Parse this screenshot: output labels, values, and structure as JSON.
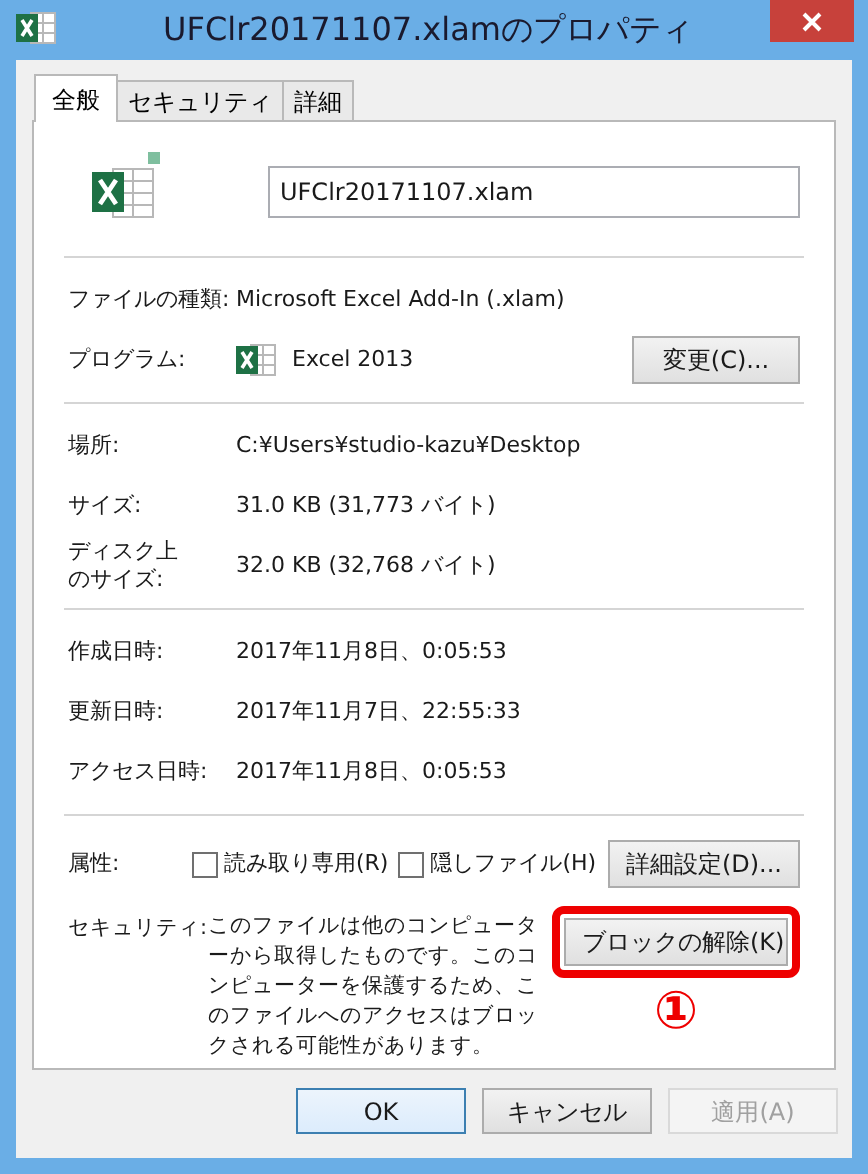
{
  "window": {
    "title": "UFClr20171107.xlamのプロパティ"
  },
  "tabs": [
    {
      "label": "全般",
      "selected": true
    },
    {
      "label": "セキュリティ",
      "selected": false
    },
    {
      "label": "詳細",
      "selected": false
    }
  ],
  "file_name": "UFClr20171107.xlam",
  "sections": [
    {
      "rows": [
        {
          "kind": "text",
          "label": "ファイルの種類:",
          "value": "Microsoft Excel Add-In (.xlam)"
        },
        {
          "kind": "program",
          "label": "プログラム:",
          "value": "Excel 2013",
          "button": "変更(C)..."
        }
      ]
    },
    {
      "rows": [
        {
          "kind": "text",
          "label": "場所:",
          "value": "C:¥Users¥studio-kazu¥Desktop"
        },
        {
          "kind": "text",
          "label": "サイズ:",
          "value": "31.0 KB (31,773 バイト)"
        },
        {
          "kind": "narrow_label",
          "label": "ディスク上のサイズ:",
          "value": "32.0 KB (32,768 バイト)"
        }
      ]
    },
    {
      "rows": [
        {
          "kind": "text",
          "label": "作成日時:",
          "value": "2017年11月8日、0:05:53"
        },
        {
          "kind": "text",
          "label": "更新日時:",
          "value": "2017年11月7日、22:55:33"
        },
        {
          "kind": "text",
          "label": "アクセス日時:",
          "value": "2017年11月8日、0:05:53"
        }
      ]
    }
  ],
  "attributes": {
    "label": "属性:",
    "checkboxes": [
      {
        "label": "読み取り専用(R)",
        "checked": false
      },
      {
        "label": "隠しファイル(H)",
        "checked": false
      }
    ],
    "button": "詳細設定(D)..."
  },
  "security": {
    "label": "セキュリティ:",
    "text": "このファイルは他のコンピューターから取得したものです。このコンピューターを保護するため、このファイルへのアクセスはブロックされる可能性があります。",
    "button": "ブロックの解除(K)",
    "highlighted": true,
    "annotation": "①"
  },
  "buttons": [
    {
      "label": "OK",
      "default": true,
      "disabled": false
    },
    {
      "label": "キャンセル",
      "default": false,
      "disabled": false
    },
    {
      "label": "適用(A)",
      "default": false,
      "disabled": true
    }
  ]
}
